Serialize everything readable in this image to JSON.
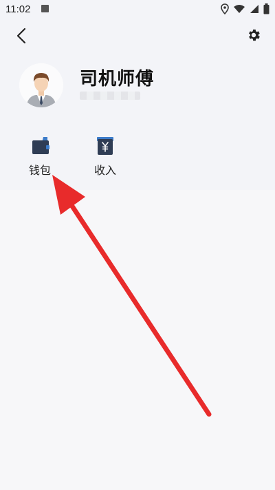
{
  "status_bar": {
    "time": "11:02",
    "icons": [
      "notification-a-icon",
      "location-icon",
      "wifi-icon",
      "signal-icon",
      "battery-icon"
    ]
  },
  "header": {
    "back_icon": "chevron-left-icon",
    "settings_icon": "gear-icon"
  },
  "profile": {
    "name": "司机师傅",
    "avatar_icon": "male-avatar-icon"
  },
  "actions": [
    {
      "label": "钱包",
      "icon": "wallet-icon"
    },
    {
      "label": "收入",
      "icon": "income-yen-icon"
    }
  ],
  "colors": {
    "background": "#f7f7f9",
    "header_background": "#f3f4f8",
    "icon_navy": "#2f3d55",
    "icon_accent": "#3d7cc9",
    "annotation_arrow": "#e82b2b"
  }
}
